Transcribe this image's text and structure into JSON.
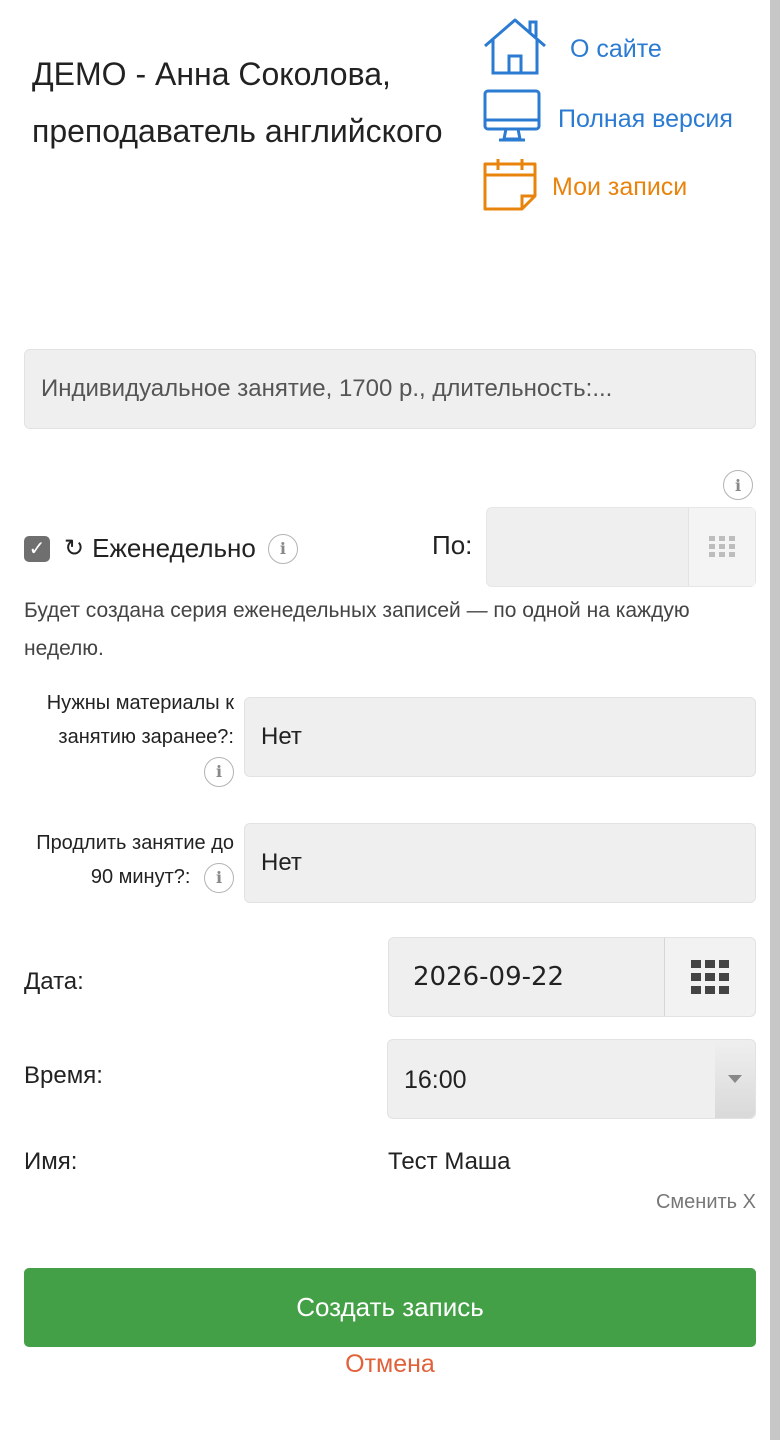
{
  "header": {
    "title": "ДЕМО - Анна Соколова, преподаватель английского",
    "nav": {
      "about": "О сайте",
      "full_version": "Полная версия",
      "my_bookings": "Мои записи"
    }
  },
  "form": {
    "service_value": "Индивидуальное занятие, 1700 р., длительность:...",
    "weekly": {
      "checked": true,
      "label": "Еженедельно",
      "until_label": "По:",
      "until_value": ""
    },
    "series_note": "Будет создана серия еженедельных записей — по одной на каждую неделю.",
    "materials": {
      "label": "Нужны материалы к занятию заранее?:",
      "value": "Нет"
    },
    "extend": {
      "label": "Продлить занятие до 90 минут?:",
      "value": "Нет"
    },
    "date": {
      "label": "Дата:",
      "value": "2026-09-22"
    },
    "time": {
      "label": "Время:",
      "value": "16:00"
    },
    "name": {
      "label": "Имя:",
      "value": "Тест Маша",
      "change_link": "Сменить X"
    },
    "submit_label": "Создать запись",
    "cancel_label": "Отмена"
  },
  "colors": {
    "link_blue": "#2a7bd1",
    "link_orange": "#e8830c",
    "submit_green": "#44a046",
    "cancel_red": "#e0613a"
  },
  "icons": [
    "home-icon",
    "monitor-icon",
    "calendar-icon",
    "info-icon",
    "repeat-icon",
    "grid-icon",
    "chevron-down-icon"
  ]
}
